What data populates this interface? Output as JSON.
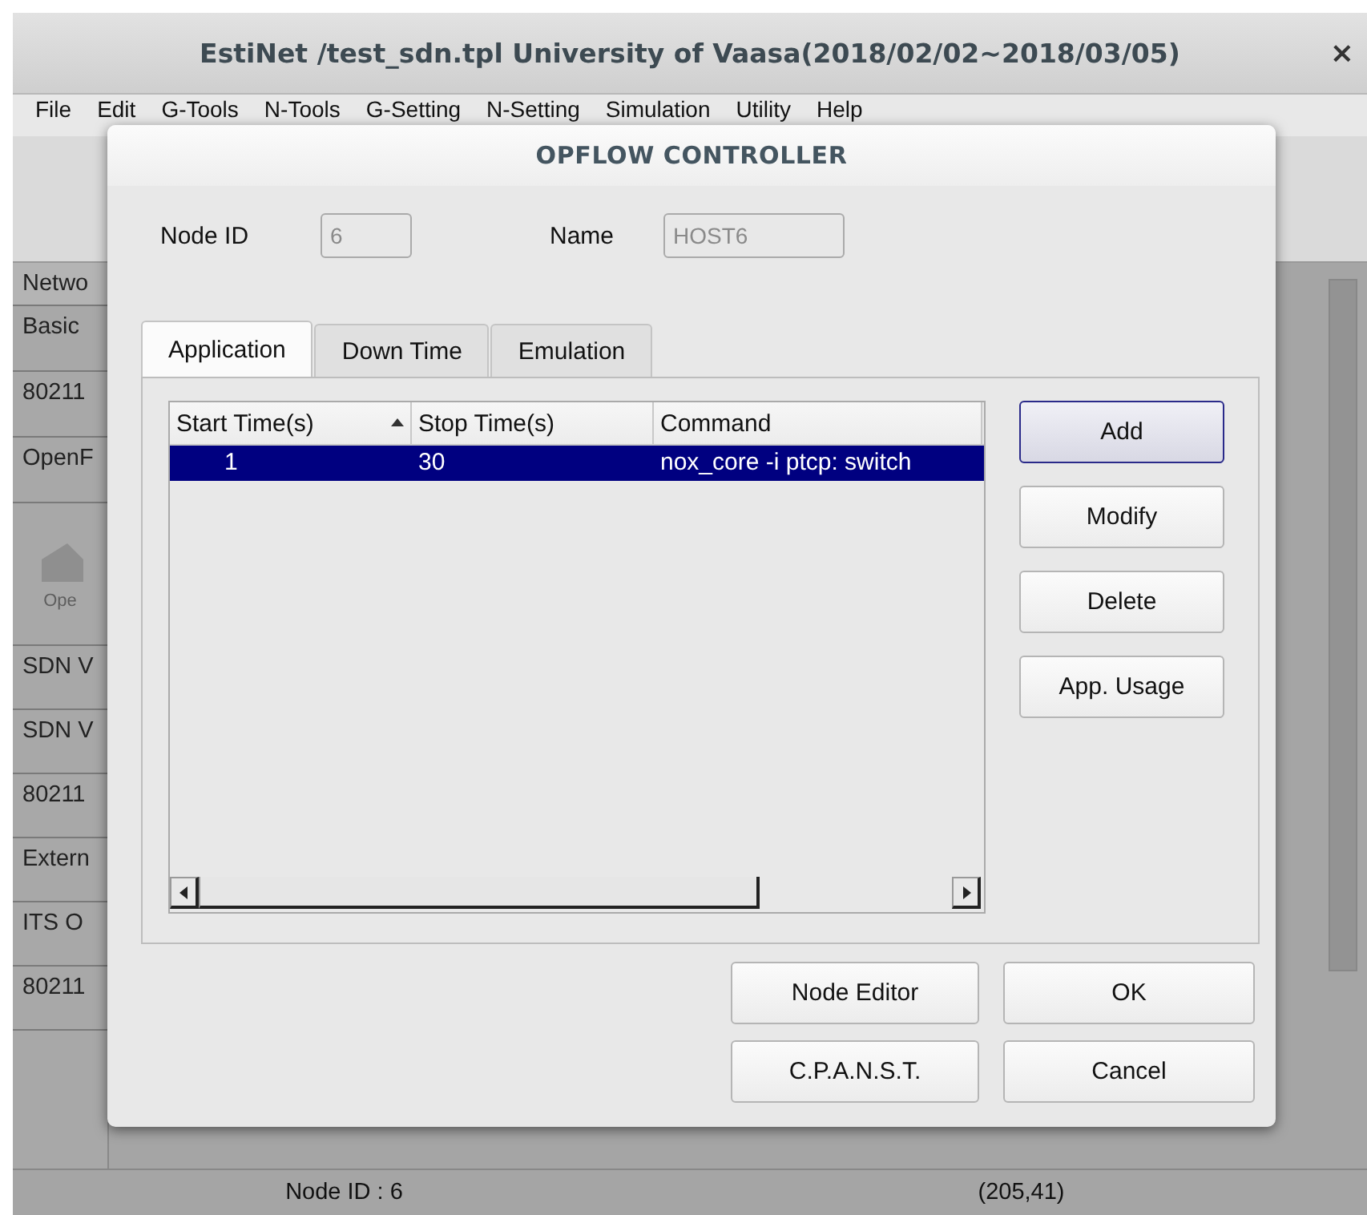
{
  "window": {
    "title": "EstiNet /test_sdn.tpl University of Vaasa(2018/02/02~2018/03/05)",
    "close": "×"
  },
  "menu": [
    "File",
    "Edit",
    "G-Tools",
    "N-Tools",
    "G-Setting",
    "N-Setting",
    "Simulation",
    "Utility",
    "Help"
  ],
  "sidebar": {
    "items": [
      {
        "label": "Netwo",
        "kind": "header"
      },
      {
        "label": "Basic",
        "kind": "item"
      },
      {
        "label": "80211",
        "kind": "item"
      },
      {
        "label": "OpenF",
        "kind": "item"
      },
      {
        "label": "Ope",
        "kind": "icon"
      },
      {
        "label": "SDN V",
        "kind": "item"
      },
      {
        "label": "SDN V",
        "kind": "item"
      },
      {
        "label": "80211",
        "kind": "item"
      },
      {
        "label": "Extern",
        "kind": "item"
      },
      {
        "label": "ITS O",
        "kind": "item"
      },
      {
        "label": "80211",
        "kind": "item"
      }
    ]
  },
  "dialog": {
    "title": "OPFLOW CONTROLLER",
    "fields": [
      {
        "label": "Node ID",
        "value": "6",
        "disabled": true
      },
      {
        "label": "Name",
        "value": "HOST6",
        "disabled": true
      }
    ],
    "tabs": [
      {
        "label": "Application",
        "selected": true
      },
      {
        "label": "Down Time",
        "selected": false
      },
      {
        "label": "Emulation",
        "selected": false
      }
    ],
    "table": {
      "columns": [
        {
          "label": "Start Time(s)",
          "sorted": true
        },
        {
          "label": "Stop Time(s)",
          "sorted": false
        },
        {
          "label": "Command",
          "sorted": false
        }
      ],
      "rows": [
        {
          "cells": [
            "1",
            "30",
            "nox_core -i ptcp: switch"
          ],
          "selected": true
        }
      ]
    },
    "side_buttons": [
      {
        "label": "Add",
        "focused": true
      },
      {
        "label": "Modify",
        "focused": false
      },
      {
        "label": "Delete",
        "focused": false
      },
      {
        "label": "App. Usage",
        "focused": false
      }
    ],
    "bottom_buttons": [
      "Node Editor",
      "OK",
      "C.P.A.N.S.T.",
      "Cancel"
    ]
  },
  "status_bar": {
    "node": "Node ID : 6",
    "coords": "(205,41)"
  }
}
